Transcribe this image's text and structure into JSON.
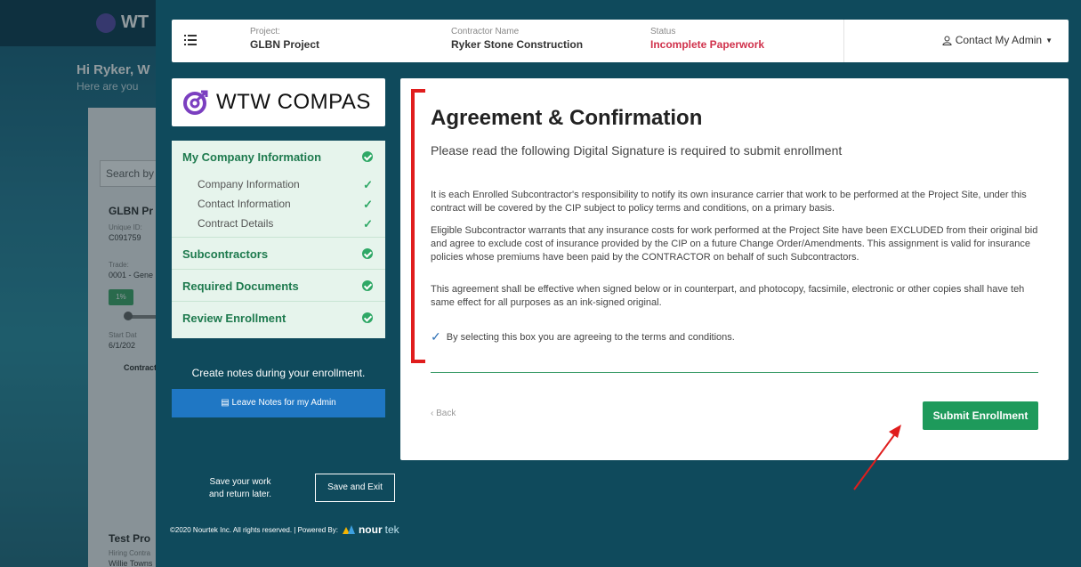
{
  "background": {
    "brand": "WT",
    "greeting": "Hi Ryker, W",
    "subgreeting": "Here are you",
    "search": "Search by",
    "project": "GLBN Pr",
    "unique_label": "Unique ID:",
    "unique_id": "C091759",
    "trade_label": "Trade:",
    "trade": "0001 - Gene",
    "pill": "1%",
    "start_label": "Start Dat",
    "start_date": "6/1/202",
    "contract": "Contract",
    "test_project": "Test Pro",
    "hiring_label": "Hiring Contra",
    "hiring_name": "Willie Towns"
  },
  "header": {
    "project_label": "Project:",
    "project_value": "GLBN Project",
    "contractor_label": "Contractor Name",
    "contractor_value": "Ryker Stone Construction",
    "status_label": "Status",
    "status_value": "Incomplete Paperwork",
    "status_color": "#d0314b",
    "admin_link": "Contact My Admin"
  },
  "sidebar": {
    "logo_text": "WTW COMPAS",
    "sections": [
      {
        "label": "My Company Information",
        "items": [
          "Company Information",
          "Contact Information",
          "Contract Details"
        ]
      },
      {
        "label": "Subcontractors"
      },
      {
        "label": "Required Documents"
      },
      {
        "label": "Review Enrollment"
      }
    ],
    "notes_text": "Create notes during your enrollment.",
    "notes_button": "Leave Notes for my Admin",
    "save_note_line1": "Save your work",
    "save_note_line2": "and return later.",
    "save_button": "Save and Exit",
    "footer_text": "©2020 Nourtek Inc. All rights reserved. | Powered By:",
    "footer_brand_a": "nour",
    "footer_brand_b": "tek"
  },
  "main": {
    "title": "Agreement & Confirmation",
    "subtitle": "Please read the following Digital Signature is required to submit enrollment",
    "paragraph1": "It is each Enrolled Subcontractor's responsibility to notify its own insurance carrier that work to be performed at the Project Site, under this contract will be covered by the CIP subject to policy terms and conditions, on a primary basis.",
    "paragraph2": "Eligible Subcontractor warrants that any insurance costs for work performed at the Project Site have been EXCLUDED from their original bid and agree to exclude cost of insurance provided by the CIP on a future Change Order/Amendments.  This assignment is valid for insurance policies whose premiums have been paid by the CONTRACTOR on behalf of such Subcontractors.",
    "paragraph3": "This agreement shall be effective when signed below or in counterpart, and photocopy, facsimile, electronic or other copies shall have teh same effect for all purposes as an ink-signed original.",
    "agree_text": "By selecting this box you are agreeing to the terms and conditions.",
    "back_label": "Back",
    "submit_label": "Submit Enrollment"
  },
  "colors": {
    "accent_green": "#1e9a5b",
    "annotation_red": "#e01d1d",
    "notes_blue": "#1f77c4"
  }
}
